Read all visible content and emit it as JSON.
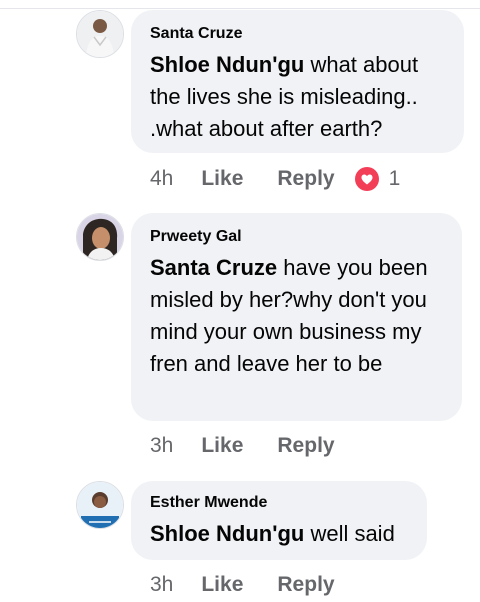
{
  "comments": [
    {
      "author": "Santa Cruze",
      "mention": "Shloe Ndun'gu",
      "text": " what about the lives she is misleading.. .what about after earth?",
      "time": "4h",
      "like_label": "Like",
      "reply_label": "Reply",
      "reaction": {
        "icon": "love-reaction-icon",
        "count": "1",
        "color": "#f33e58"
      }
    },
    {
      "author": "Prweety Gal",
      "mention": "Santa Cruze",
      "text": " have you been misled by her?why don't you mind your own business my fren and leave her to be",
      "time": "3h",
      "like_label": "Like",
      "reply_label": "Reply"
    },
    {
      "author": "Esther Mwende",
      "mention": "Shloe Ndun'gu",
      "text": " well said",
      "time": "3h",
      "like_label": "Like",
      "reply_label": "Reply"
    }
  ],
  "colors": {
    "bubble": "#f0f2f5",
    "secondary_text": "#65676b",
    "primary_text": "#050505"
  }
}
